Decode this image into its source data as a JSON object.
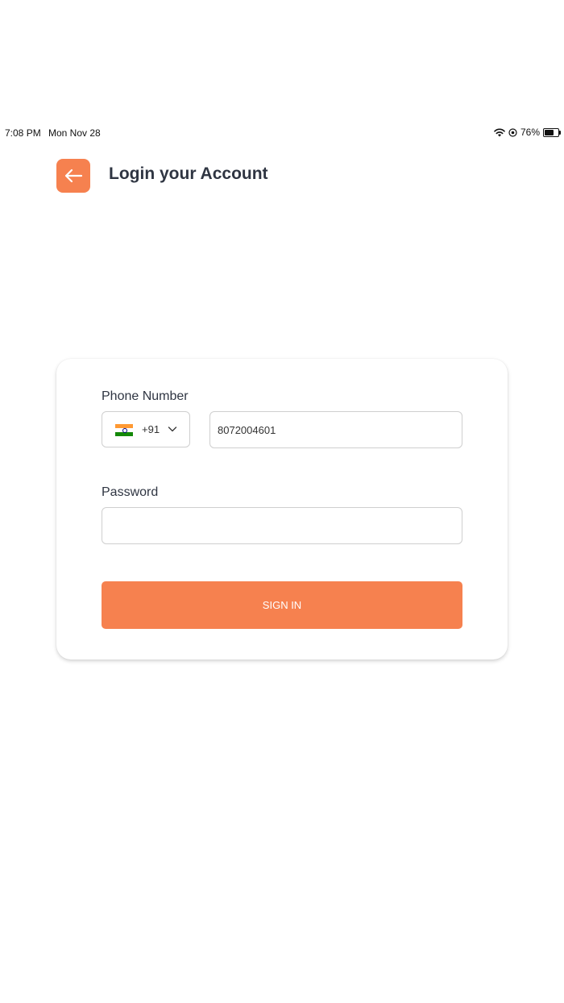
{
  "status_bar": {
    "time": "7:08 PM",
    "date": "Mon Nov 28",
    "battery": "76%",
    "battery_level": 0.76
  },
  "header": {
    "title": "Login your Account",
    "back_icon": "arrow-left-icon"
  },
  "form": {
    "phone_label": "Phone Number",
    "country_flag": "india-flag-icon",
    "dial_code": "+91",
    "phone_value": "8072004601",
    "password_label": "Password",
    "password_value": "",
    "signin_label": "SIGN IN"
  },
  "colors": {
    "accent": "#f6814f",
    "title": "#2f3542",
    "border": "#cfcfcf",
    "flag_saffron": "#ff9933",
    "flag_white": "#ffffff",
    "flag_green": "#138808",
    "flag_chakra": "#000080"
  }
}
